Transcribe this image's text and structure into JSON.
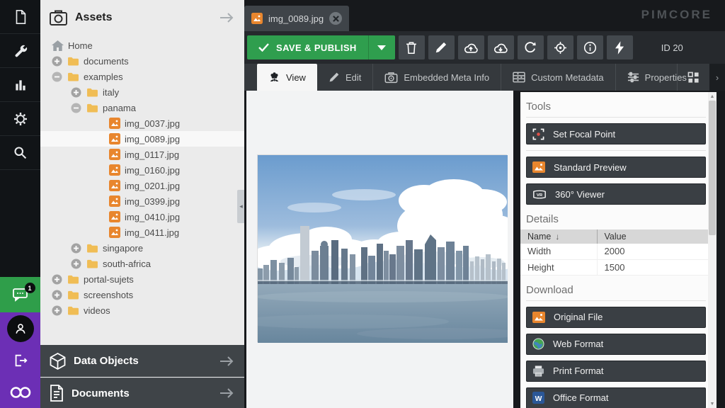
{
  "brand": {
    "wordmark": "PIMCORE"
  },
  "left_rail": {
    "notification_count": "1"
  },
  "assets_panel": {
    "title": "Assets",
    "tree": [
      {
        "label": "Home"
      },
      {
        "label": "documents"
      },
      {
        "label": "examples"
      },
      {
        "label": "italy"
      },
      {
        "label": "panama"
      },
      {
        "label": "img_0037.jpg"
      },
      {
        "label": "img_0089.jpg",
        "selected": true
      },
      {
        "label": "img_0117.jpg"
      },
      {
        "label": "img_0160.jpg"
      },
      {
        "label": "img_0201.jpg"
      },
      {
        "label": "img_0399.jpg"
      },
      {
        "label": "img_0410.jpg"
      },
      {
        "label": "img_0411.jpg"
      },
      {
        "label": "singapore"
      },
      {
        "label": "south-africa"
      },
      {
        "label": "portal-sujets"
      },
      {
        "label": "screenshots"
      },
      {
        "label": "videos"
      }
    ]
  },
  "section_panels": {
    "data_objects": "Data Objects",
    "documents": "Documents"
  },
  "workspace": {
    "file_tab": {
      "label": "img_0089.jpg"
    },
    "toolbar": {
      "save_label": "SAVE & PUBLISH",
      "id_label": "ID 20"
    },
    "view_tabs": {
      "view": "View",
      "edit": "Edit",
      "embedded_meta": "Embedded Meta Info",
      "custom_metadata": "Custom Metadata",
      "properties": "Properties"
    }
  },
  "preview": {
    "image_alt": "Panama City skyline with skyscrapers, cumulus clouds and sea"
  },
  "right_panel": {
    "tools": {
      "heading": "Tools",
      "set_focal_point": "Set Focal Point",
      "standard_preview": "Standard Preview",
      "viewer_360": "360° Viewer"
    },
    "details": {
      "heading": "Details",
      "columns": {
        "name": "Name",
        "value": "Value"
      },
      "rows": [
        {
          "name": "Width",
          "value": "2000"
        },
        {
          "name": "Height",
          "value": "1500"
        }
      ]
    },
    "download": {
      "heading": "Download",
      "original_file": "Original File",
      "web_format": "Web Format",
      "print_format": "Print Format",
      "office_format": "Office Format"
    }
  },
  "colors": {
    "save_green": "#2f9e4e",
    "rail_green": "#2f9e4a",
    "pimcore_purple": "#6c2fb5",
    "asset_orange": "#e8862e",
    "folder_yellow": "#f0bd55",
    "dark_chrome": "#3f4448"
  }
}
